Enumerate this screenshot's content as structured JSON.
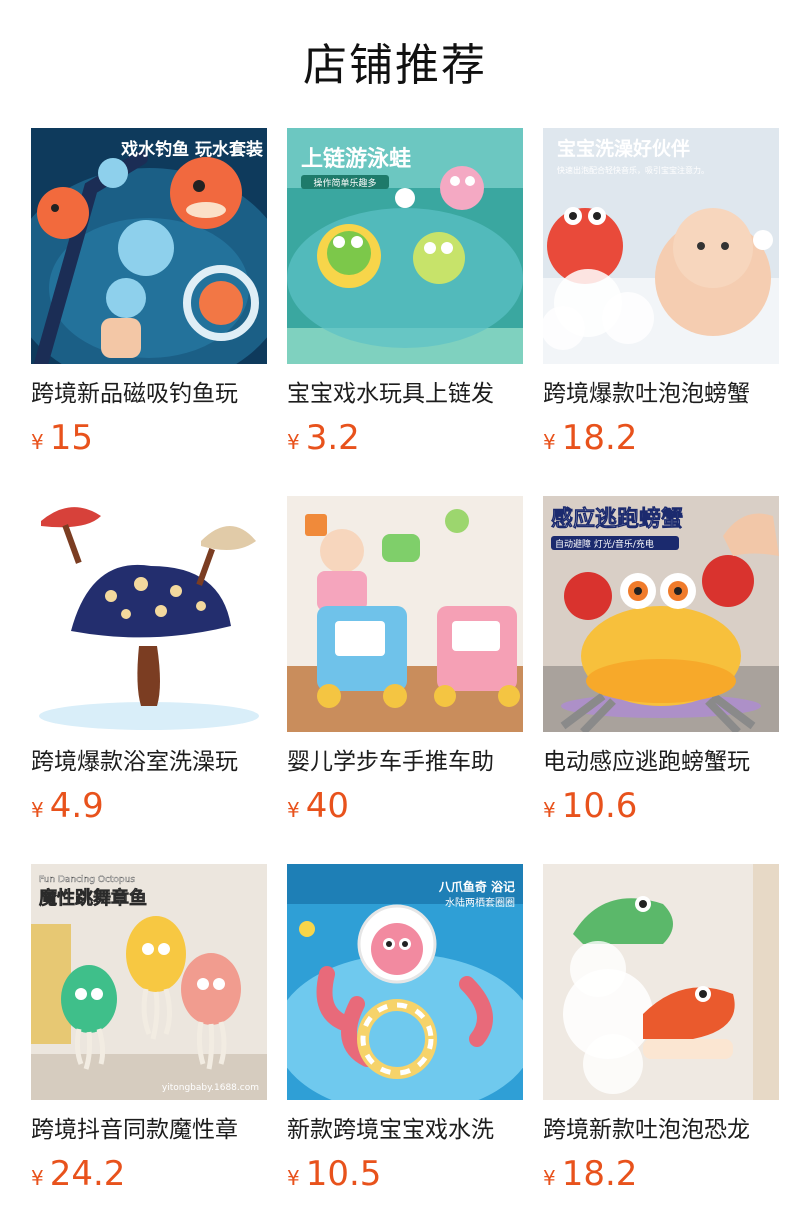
{
  "header": {
    "title": "店铺推荐"
  },
  "products": [
    {
      "title": "跨境新品磁吸钓鱼玩",
      "currency": "¥",
      "price": "15",
      "image_caption": "戏水钓鱼 玩水套装",
      "image_subcaption": ""
    },
    {
      "title": "宝宝戏水玩具上链发",
      "currency": "¥",
      "price": "3.2",
      "image_caption": "上链游泳蛙",
      "image_subcaption": "操作简单乐趣多"
    },
    {
      "title": "跨境爆款吐泡泡螃蟹",
      "currency": "¥",
      "price": "18.2",
      "image_caption": "宝宝洗澡好伙伴",
      "image_subcaption": "快速出泡配合轻快音乐，吸引宝宝注意力。"
    },
    {
      "title": "跨境爆款浴室洗澡玩",
      "currency": "¥",
      "price": "4.9",
      "image_caption": "",
      "image_subcaption": ""
    },
    {
      "title": "婴儿学步车手推车助",
      "currency": "¥",
      "price": "40",
      "image_caption": "",
      "image_subcaption": ""
    },
    {
      "title": "电动感应逃跑螃蟹玩",
      "currency": "¥",
      "price": "10.6",
      "image_caption": "感应逃跑螃蟹",
      "image_subcaption": "自动避障 灯光/音乐/充电"
    },
    {
      "title": "跨境抖音同款魔性章",
      "currency": "¥",
      "price": "24.2",
      "image_caption": "魔性跳舞章鱼",
      "image_subcaption": "Fun Dancing Octopus",
      "image_watermark": "yitongbaby.1688.com"
    },
    {
      "title": "新款跨境宝宝戏水洗",
      "currency": "¥",
      "price": "10.5",
      "image_caption": "八爪鱼奇 浴记",
      "image_subcaption": "水陆两栖套圈圈"
    },
    {
      "title": "跨境新款吐泡泡恐龙",
      "currency": "¥",
      "price": "18.2",
      "image_caption": "",
      "image_subcaption": ""
    }
  ]
}
